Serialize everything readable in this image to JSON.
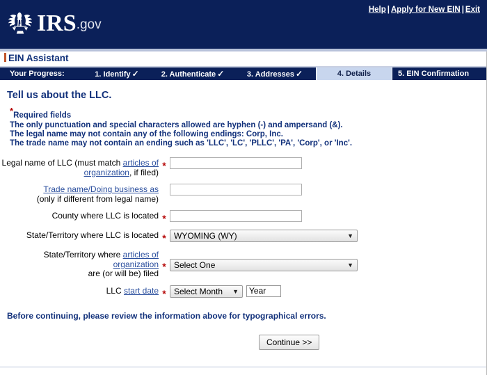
{
  "header": {
    "logo_alt": "IRS eagle and scales seal",
    "brand_primary": "IRS",
    "brand_suffix": ".gov",
    "links": [
      {
        "label": "Help"
      },
      {
        "label": "Apply for New EIN"
      },
      {
        "label": "Exit"
      }
    ],
    "separator": "|",
    "bg_color": "#0b2059"
  },
  "app": {
    "name": "EIN Assistant"
  },
  "progress": {
    "label": "Your Progress:",
    "check_glyph": "✓",
    "active_bg": "#c8d6ee",
    "steps": [
      {
        "label": "1. Identify",
        "complete": true
      },
      {
        "label": "2. Authenticate",
        "complete": true
      },
      {
        "label": "3. Addresses",
        "complete": true
      },
      {
        "label": "4. Details",
        "complete": false,
        "active": true
      },
      {
        "label": "5. EIN Confirmation",
        "complete": false
      }
    ]
  },
  "main": {
    "heading": "Tell us about the LLC.",
    "required_note": "Required fields",
    "notes": [
      "The only punctuation and special characters allowed are hyphen (-) and ampersand (&).",
      "The legal name may not contain any of the following endings: Corp, Inc.",
      "The trade name may not contain an ending such as 'LLC', 'LC', 'PLLC', 'PA', 'Corp', or 'Inc'."
    ],
    "note_color": "#12317b",
    "required_star_color": "#b50707",
    "fields": {
      "legal_name": {
        "label_pre": "Legal name of LLC (must match ",
        "label_link": "articles of organization",
        "label_post": ", if filed)",
        "required": true,
        "value": "",
        "placeholder": ""
      },
      "trade_name": {
        "label_link": "Trade name/Doing business as",
        "label_sub": "(only if different from legal name)",
        "required": false,
        "value": "",
        "placeholder": ""
      },
      "county": {
        "label": "County where LLC is located",
        "required": true,
        "value": "",
        "placeholder": ""
      },
      "state_located": {
        "label": "State/Territory where LLC is located",
        "required": true,
        "selected": "WYOMING (WY)"
      },
      "state_filed": {
        "label_pre": "State/Territory where ",
        "label_link": "articles of organization",
        "label_post_line": "are (or will be) filed",
        "required": true,
        "selected": "Select One"
      },
      "start_date": {
        "label_pre": "LLC ",
        "label_link": "start date",
        "required": true,
        "month_selected": "Select Month",
        "year_value": "Year"
      }
    },
    "before_continue_note": "Before continuing, please review the information above for typographical errors.",
    "continue_label": "Continue >>"
  }
}
